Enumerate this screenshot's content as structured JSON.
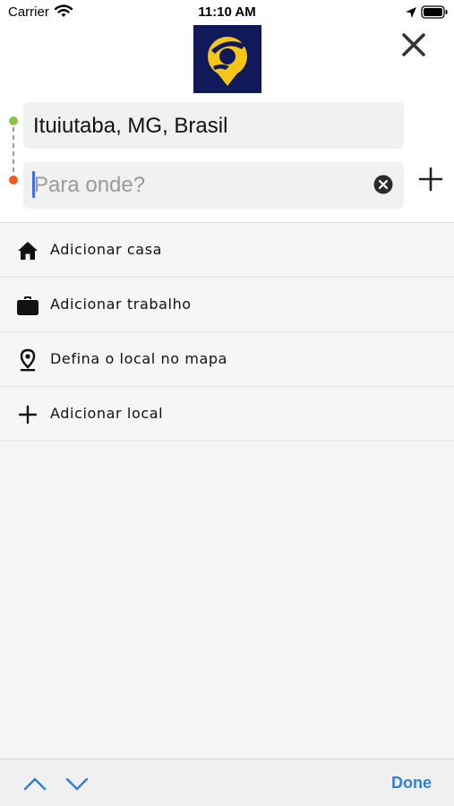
{
  "status_bar": {
    "carrier": "Carrier",
    "time": "11:10 AM",
    "icons": [
      "wifi-icon",
      "location-arrow-icon",
      "battery-icon"
    ]
  },
  "header": {
    "logo": "app-logo",
    "close_icon": "close-icon",
    "origin": {
      "value": "Ituiutaba, MG, Brasil",
      "marker_color": "#8bc34a"
    },
    "destination": {
      "value": "",
      "placeholder": "Para onde?",
      "marker_color": "#f15a24",
      "clear_icon": "clear-circle-icon"
    },
    "add_stop_icon": "plus-icon"
  },
  "list": {
    "items": [
      {
        "label": "Adicionar casa",
        "icon": "home-icon"
      },
      {
        "label": "Adicionar trabalho",
        "icon": "briefcase-icon"
      },
      {
        "label": "Defina o local no mapa",
        "icon": "map-pin-icon"
      },
      {
        "label": "Adicionar local",
        "icon": "plus-icon"
      }
    ]
  },
  "keyboard_toolbar": {
    "done_label": "Done",
    "accent": "#2f7fd8",
    "icons": [
      "chevron-up-icon",
      "chevron-down-icon"
    ]
  },
  "colors": {
    "logo_background": "#101a5a",
    "logo_yellow": "#f5c518",
    "caret": "#3c6cf0"
  }
}
